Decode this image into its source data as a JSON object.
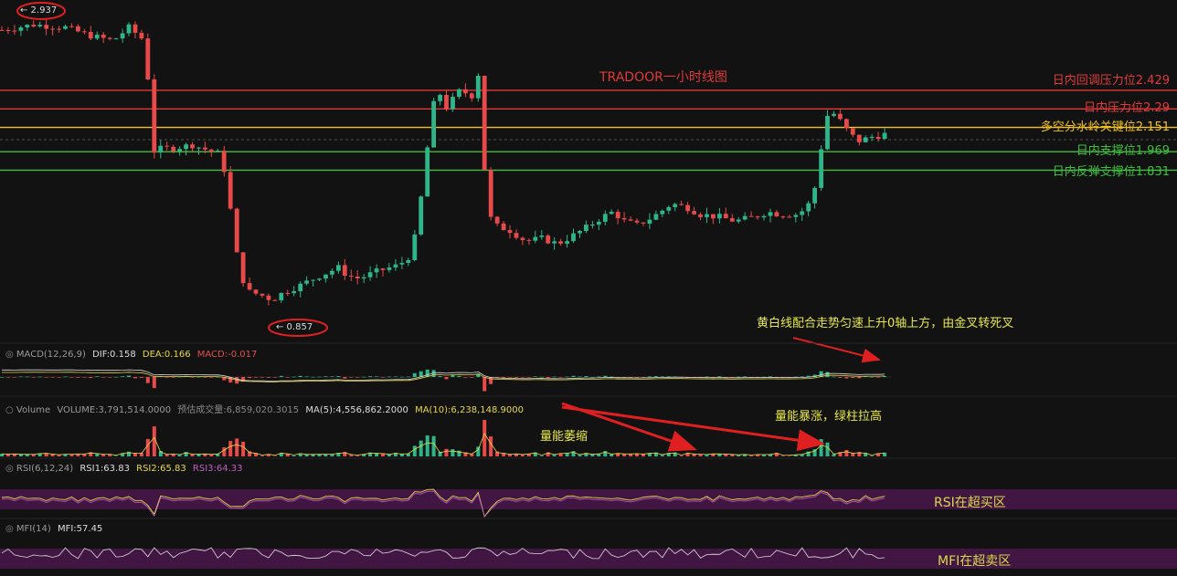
{
  "chart_data": {
    "type": "candlestick",
    "title": "TRADOOR一小时线图",
    "price_range": [
      0.6,
      3.0
    ],
    "markers": {
      "high_label": "← 2.937",
      "low_label": "← 0.857"
    },
    "levels": [
      {
        "label": "日内回调压力位2.429",
        "value": 2.429,
        "color": "#e03a3a"
      },
      {
        "label": "日内压力位2.29",
        "value": 2.29,
        "color": "#e03a3a"
      },
      {
        "label": "多空分水岭关键位2.151",
        "value": 2.151,
        "color": "#f0c020"
      },
      {
        "label": "日内支撑位1.969",
        "value": 1.969,
        "color": "#3fbf3f"
      },
      {
        "label": "日内反弹支撑位1.831",
        "value": 1.831,
        "color": "#3fbf3f"
      }
    ],
    "close_path": [
      [
        0,
        2.88
      ],
      [
        20,
        2.92
      ],
      [
        40,
        2.9
      ],
      [
        55,
        2.84
      ],
      [
        70,
        2.8
      ],
      [
        80,
        2.9
      ],
      [
        88,
        2.82
      ],
      [
        93,
        2.45
      ],
      [
        95,
        1.97
      ],
      [
        100,
        1.99
      ],
      [
        110,
        2.0
      ],
      [
        120,
        2.02
      ],
      [
        130,
        1.98
      ],
      [
        138,
        1.95
      ],
      [
        142,
        1.72
      ],
      [
        146,
        1.35
      ],
      [
        150,
        1.05
      ],
      [
        156,
        0.92
      ],
      [
        165,
        0.89
      ],
      [
        170,
        0.86
      ],
      [
        178,
        0.92
      ],
      [
        188,
        0.97
      ],
      [
        200,
        1.04
      ],
      [
        212,
        1.1
      ],
      [
        218,
        1.04
      ],
      [
        225,
        1.02
      ],
      [
        238,
        1.08
      ],
      [
        250,
        1.12
      ],
      [
        258,
        1.2
      ],
      [
        262,
        1.45
      ],
      [
        266,
        1.8
      ],
      [
        270,
        2.2
      ],
      [
        274,
        2.45
      ],
      [
        280,
        2.3
      ],
      [
        290,
        2.45
      ],
      [
        295,
        2.35
      ],
      [
        300,
        2.55
      ],
      [
        303,
        2.0
      ],
      [
        306,
        1.52
      ],
      [
        310,
        1.42
      ],
      [
        320,
        1.38
      ],
      [
        330,
        1.3
      ],
      [
        340,
        1.32
      ],
      [
        350,
        1.28
      ],
      [
        358,
        1.33
      ],
      [
        368,
        1.4
      ],
      [
        378,
        1.48
      ],
      [
        385,
        1.52
      ],
      [
        392,
        1.45
      ],
      [
        400,
        1.42
      ],
      [
        410,
        1.48
      ],
      [
        422,
        1.58
      ],
      [
        432,
        1.55
      ],
      [
        440,
        1.5
      ],
      [
        452,
        1.48
      ],
      [
        462,
        1.45
      ],
      [
        474,
        1.48
      ],
      [
        482,
        1.52
      ],
      [
        490,
        1.5
      ],
      [
        502,
        1.5
      ],
      [
        510,
        1.6
      ],
      [
        514,
        1.8
      ],
      [
        518,
        2.2
      ],
      [
        522,
        2.28
      ],
      [
        528,
        2.2
      ],
      [
        534,
        2.1
      ],
      [
        540,
        2.05
      ],
      [
        548,
        2.08
      ],
      [
        556,
        2.1
      ]
    ],
    "indicators": {
      "macd": {
        "params": "MACD(12,26,9)",
        "dif": "DIF:0.158",
        "dea": "DEA:0.166",
        "macd": "MACD:-0.017"
      },
      "volume": {
        "params": "Volume",
        "volume": "VOLUME:3,791,514.0000",
        "est": "预估成交量:6,859,020.3015",
        "ma5": "MA(5):4,556,862.2000",
        "ma10": "MA(10):6,238,148.9000"
      },
      "rsi": {
        "params": "RSI(6,12,24)",
        "rsi1": "RSI1:63.83",
        "rsi2": "RSI2:65.83",
        "rsi3": "RSI3:64.33"
      },
      "mfi": {
        "params": "MFI(14)",
        "mfi": "MFI:57.45"
      }
    },
    "annotations": {
      "macd_note": "黄白线配合走势匀速上升0轴上方，由金叉转死叉",
      "volume_shrink": "量能萎缩",
      "volume_surge": "量能暴涨，绿柱拉高",
      "rsi_band": "RSI在超买区",
      "mfi_band": "MFI在超卖区"
    }
  }
}
